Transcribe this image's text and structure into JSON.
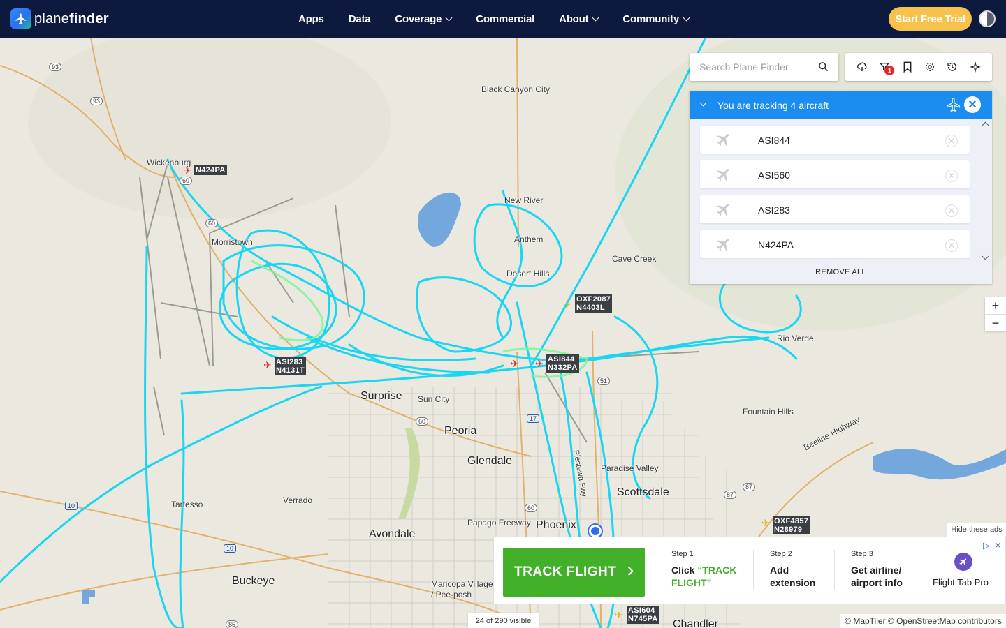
{
  "brand": {
    "name_light": "plane",
    "name_bold": "finder"
  },
  "nav": {
    "items": [
      {
        "label": "Apps",
        "dropdown": false
      },
      {
        "label": "Data",
        "dropdown": false
      },
      {
        "label": "Coverage",
        "dropdown": true
      },
      {
        "label": "Commercial",
        "dropdown": false
      },
      {
        "label": "About",
        "dropdown": true
      },
      {
        "label": "Community",
        "dropdown": true
      }
    ],
    "cta": "Start Free Trial"
  },
  "search": {
    "placeholder": "Search Plane Finder"
  },
  "toolbar": {
    "filter_badge": "1",
    "icons": [
      "weather-icon",
      "filter-icon",
      "bookmark-icon",
      "settings-icon",
      "history-icon",
      "3d-view-icon"
    ]
  },
  "tracking": {
    "title": "You are tracking 4 aircraft",
    "items": [
      "ASI844",
      "ASI560",
      "ASI283",
      "N424PA"
    ],
    "remove_all": "REMOVE ALL"
  },
  "zoom": {
    "in": "+",
    "out": "−"
  },
  "map": {
    "places": [
      {
        "name": "Black Canyon City",
        "size": "small"
      },
      {
        "name": "Wickenburg",
        "size": "small"
      },
      {
        "name": "Morristown",
        "size": "small"
      },
      {
        "name": "New River",
        "size": "small"
      },
      {
        "name": "Anthem",
        "size": "small"
      },
      {
        "name": "Desert Hills",
        "size": "small"
      },
      {
        "name": "Cave Creek",
        "size": "small"
      },
      {
        "name": "Rio Verde",
        "size": "small"
      },
      {
        "name": "Surprise",
        "size": "big"
      },
      {
        "name": "Sun City",
        "size": "small"
      },
      {
        "name": "Peoria",
        "size": "big"
      },
      {
        "name": "Glendale",
        "size": "big"
      },
      {
        "name": "Fountain Hills",
        "size": "small"
      },
      {
        "name": "Paradise Valley",
        "size": "small"
      },
      {
        "name": "Scottsdale",
        "size": "big"
      },
      {
        "name": "Tartesso",
        "size": "small"
      },
      {
        "name": "Verrado",
        "size": "small"
      },
      {
        "name": "Papago Freeway",
        "size": "small"
      },
      {
        "name": "Phoenix",
        "size": "big"
      },
      {
        "name": "Avondale",
        "size": "big"
      },
      {
        "name": "Buckeye",
        "size": "big"
      },
      {
        "name": "Maricopa Village / Pee-posh",
        "size": "small"
      },
      {
        "name": "Chandler",
        "size": "big"
      },
      {
        "name": "Beeline Highway",
        "size": "small"
      },
      {
        "name": "Piestewa Fwy",
        "size": "small"
      }
    ],
    "flight_tags": [
      {
        "text": "N424PA"
      },
      {
        "text": "ASI283\nN4131T"
      },
      {
        "text": "ASI844\nN332PA"
      },
      {
        "text": "OXF2087\nN4403L"
      },
      {
        "text": "OXF4857\nN28979"
      },
      {
        "text": "ASI604\nN745PA"
      }
    ],
    "highway_shields": [
      "93",
      "93",
      "60",
      "60",
      "51",
      "60",
      "17",
      "60",
      "87",
      "87",
      "10",
      "10",
      "85"
    ],
    "visible_count": "24 of 290 visible",
    "attribution": "© MapTiler © OpenStreetMap contributors"
  },
  "ad": {
    "hide": "Hide these ads",
    "button": "TRACK FLIGHT",
    "steps": [
      {
        "label": "Step 1",
        "text_a": "Click ",
        "text_b": "“TRACK FLIGHT”"
      },
      {
        "label": "Step 2",
        "text_a": "Add extension",
        "text_b": ""
      },
      {
        "label": "Step 3",
        "text_a": "Get airline/ airport info",
        "text_b": ""
      }
    ],
    "brand": "Flight Tab Pro"
  },
  "colors": {
    "nav_bg": "#0e1a3d",
    "cta": "#f6c24b",
    "track_blue": "#1b8cf0",
    "flight_path": "#1ad6f2",
    "ad_green": "#43b02a"
  }
}
